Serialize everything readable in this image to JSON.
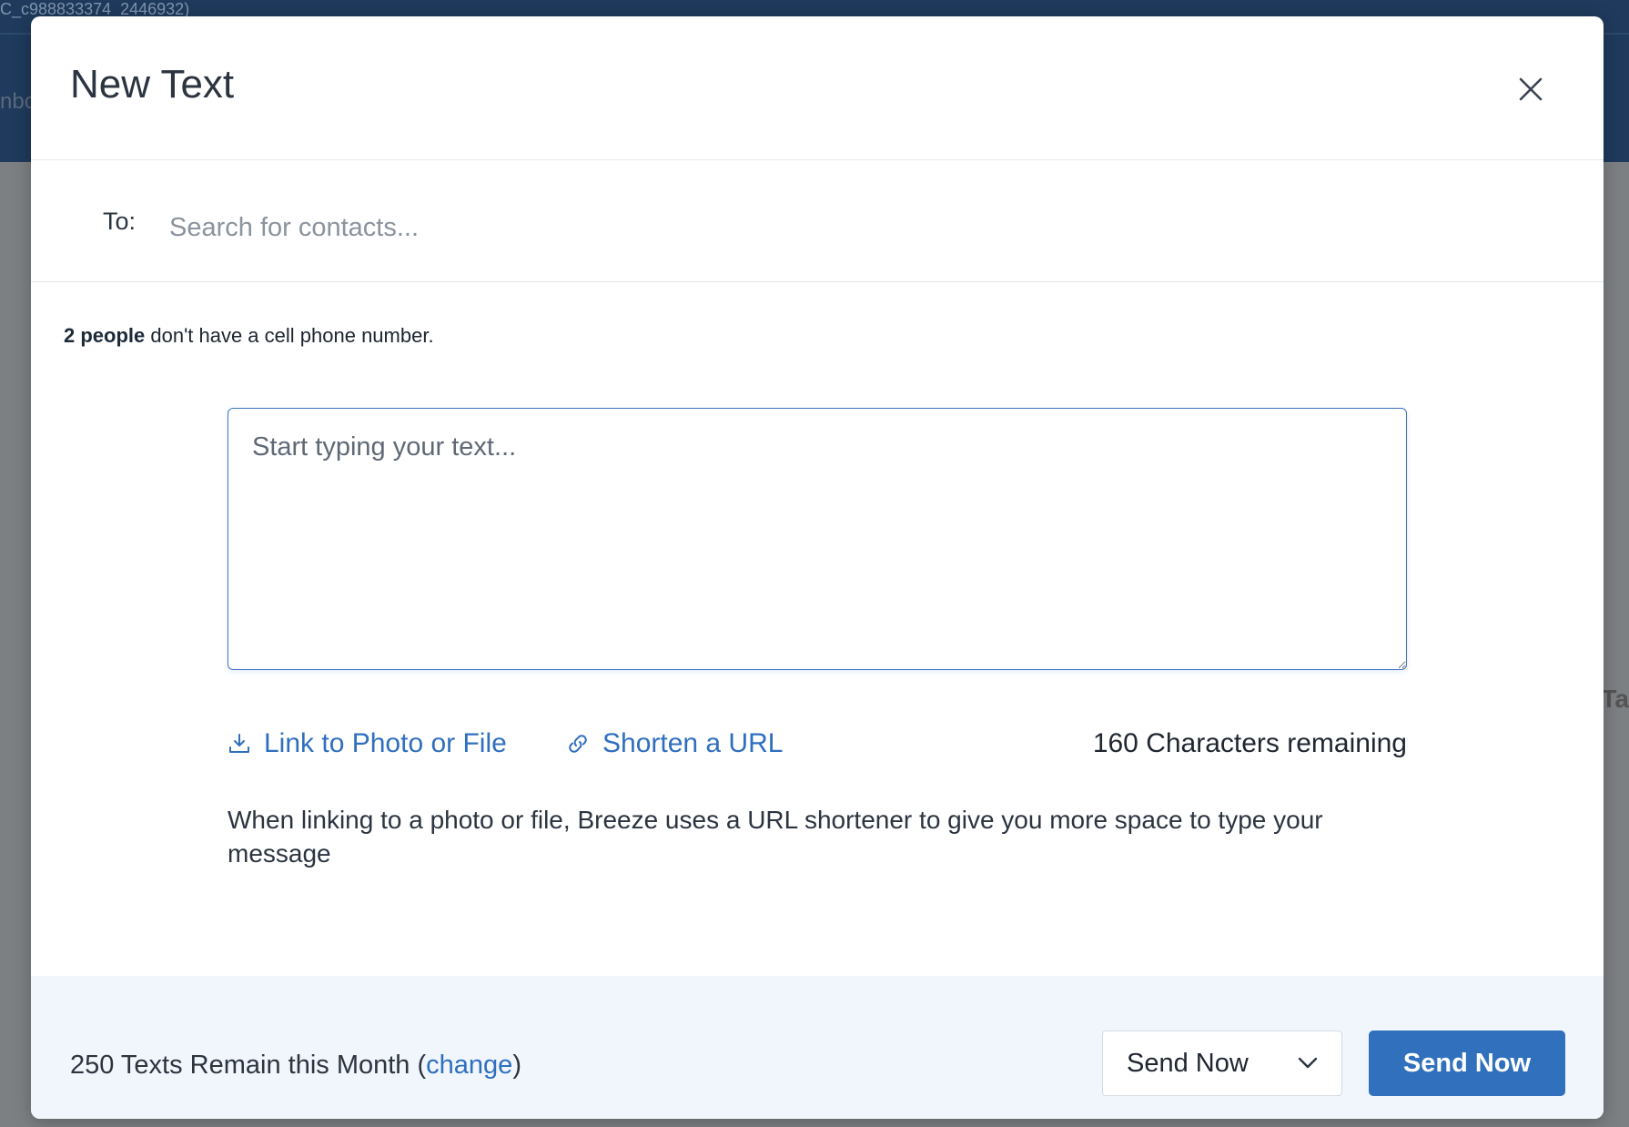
{
  "background": {
    "top_text": "C_c988833374_2446932)",
    "side_text": "nbo",
    "right_text": "Ta"
  },
  "modal": {
    "title": "New Text",
    "close_icon": "close-icon"
  },
  "recipients": {
    "label": "To:",
    "placeholder": "Search for contacts..."
  },
  "notice": {
    "count_bold": "2 people",
    "rest": " don't have a cell phone number."
  },
  "message": {
    "placeholder": "Start typing your text..."
  },
  "actions": {
    "link_file_label": "Link to Photo or File",
    "link_file_icon": "download-icon",
    "shorten_url_label": "Shorten a URL",
    "shorten_url_icon": "link-icon",
    "chars_remaining": "160 Characters remaining"
  },
  "help_text": "When linking to a photo or file, Breeze uses a URL shortener to give you more space to type your message",
  "footer": {
    "texts_remain_prefix": "250 Texts Remain this Month (",
    "change_label": "change",
    "texts_remain_suffix": ")",
    "send_option_selected": "Send Now",
    "send_button_label": "Send Now"
  },
  "colors": {
    "accent": "#3070bd",
    "link": "#2f6fbf",
    "footer_bg": "#f1f6fc"
  }
}
